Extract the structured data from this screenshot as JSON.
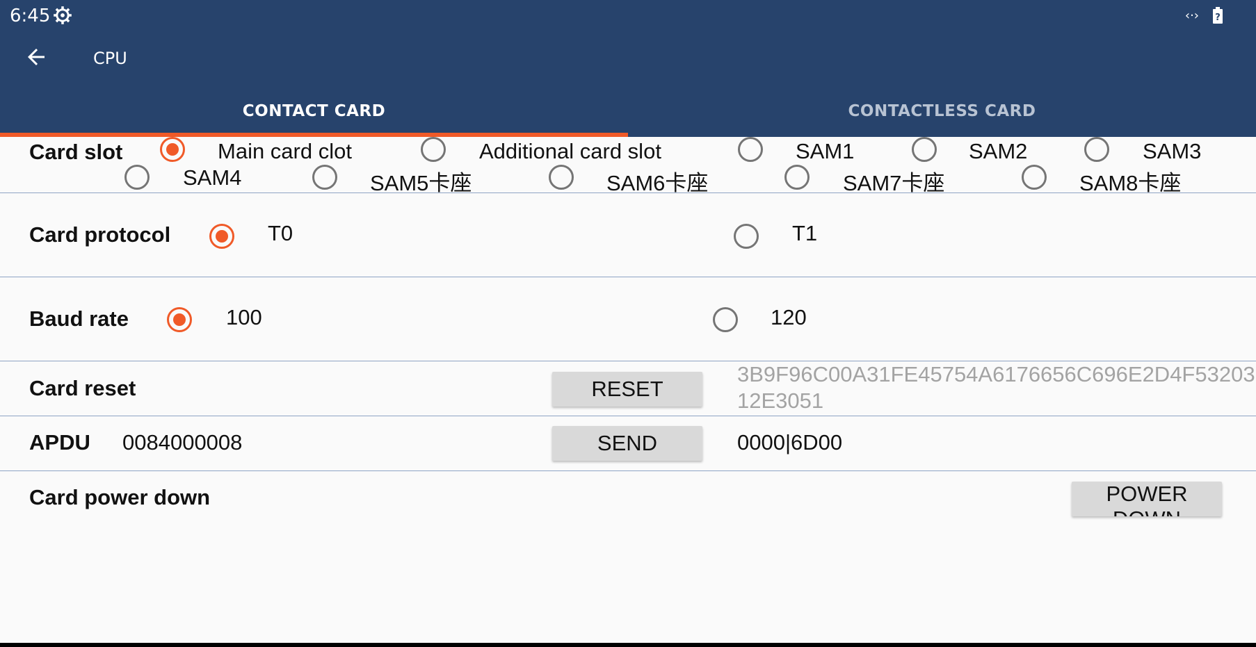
{
  "status_bar": {
    "time": "6:45",
    "settings_icon": "gear-icon",
    "network_icon": "data-sync-icon",
    "battery_icon": "battery-unknown-icon"
  },
  "app_bar": {
    "title": "CPU",
    "back_icon": "arrow-back-icon"
  },
  "tabs": [
    {
      "label": "CONTACT CARD",
      "active": true
    },
    {
      "label": "CONTACTLESS CARD",
      "active": false
    }
  ],
  "accent_color": "#f05a28",
  "header_color": "#27436c",
  "card_slot": {
    "label": "Card slot",
    "options": [
      {
        "label": "Main card clot",
        "checked": true
      },
      {
        "label": "Additional card slot",
        "checked": false
      },
      {
        "label": "SAM1",
        "checked": false
      },
      {
        "label": "SAM2",
        "checked": false
      },
      {
        "label": "SAM3",
        "checked": false
      },
      {
        "label": "SAM4",
        "checked": false
      },
      {
        "label": "SAM5卡座",
        "checked": false
      },
      {
        "label": "SAM6卡座",
        "checked": false
      },
      {
        "label": "SAM7卡座",
        "checked": false
      },
      {
        "label": "SAM8卡座",
        "checked": false
      }
    ]
  },
  "card_protocol": {
    "label": "Card protocol",
    "options": [
      {
        "label": "T0",
        "checked": true
      },
      {
        "label": "T1",
        "checked": false
      }
    ]
  },
  "baud_rate": {
    "label": "Baud rate",
    "options": [
      {
        "label": "100",
        "checked": true
      },
      {
        "label": "120",
        "checked": false
      }
    ]
  },
  "card_reset": {
    "label": "Card reset",
    "button": "RESET",
    "output": "3B9F96C00A31FE45754A6176656C696E2D4F5320312E3051"
  },
  "apdu": {
    "label": "APDU",
    "value": "0084000008",
    "button": "SEND",
    "output": "0000|6D00"
  },
  "power_down": {
    "label": "Card power down",
    "button": "POWER DOWN"
  }
}
